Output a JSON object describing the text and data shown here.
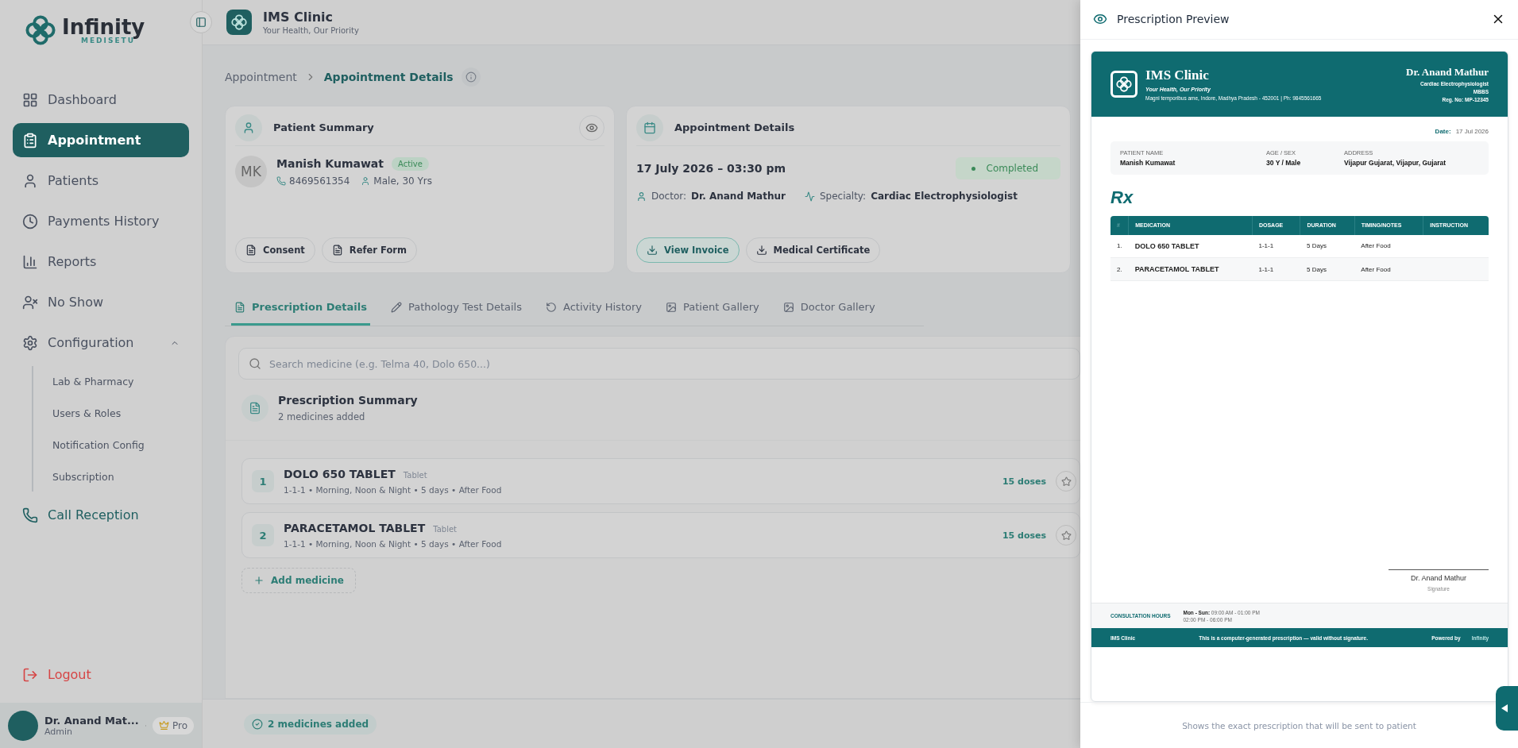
{
  "brand": {
    "name": "Infinity",
    "tagline": "MEDISETU"
  },
  "sidebar": {
    "items": [
      {
        "kind": "dashboard",
        "label": "Dashboard",
        "selected": false
      },
      {
        "kind": "appointment",
        "label": "Appointment",
        "selected": true
      },
      {
        "kind": "patients",
        "label": "Patients",
        "selected": false
      },
      {
        "kind": "payments",
        "label": "Payments History",
        "selected": false
      },
      {
        "kind": "reports",
        "label": "Reports",
        "selected": false
      },
      {
        "kind": "noshow",
        "label": "No Show",
        "selected": false
      },
      {
        "kind": "config",
        "label": "Configuration",
        "selected": false,
        "expanded": true,
        "children": [
          {
            "label": "Lab & Pharmacy"
          },
          {
            "label": "Users & Roles"
          },
          {
            "label": "Notification Config"
          },
          {
            "label": "Subscription"
          }
        ]
      },
      {
        "kind": "call",
        "label": "Call Reception",
        "selected": false
      }
    ],
    "logout": "Logout",
    "user": {
      "name": "Dr. Anand Mat...",
      "role": "Admin",
      "plan": "Pro"
    }
  },
  "header": {
    "clinic": "IMS Clinic",
    "tagline": "Your Health, Our Priority"
  },
  "breadcrumb": [
    "Appointment",
    "Appointment Details"
  ],
  "patient_card": {
    "title": "Patient Summary",
    "initials": "MK",
    "name": "Manish Kumawat",
    "status": "Active",
    "phone": "8469561354",
    "gender_age": "Male, 30 Yrs",
    "buttons": [
      "Consent",
      "Refer Form"
    ]
  },
  "appointment_card": {
    "title": "Appointment Details",
    "datetime": "17 July 2026 – 03:30 pm",
    "status": "Completed",
    "doctor_label": "Doctor:",
    "doctor": "Dr. Anand Mathur",
    "specialty_label": "Specialty:",
    "specialty": "Cardiac Electrophysiologist",
    "buttons": [
      {
        "label": "View Invoice",
        "selected": true
      },
      {
        "label": "Medical Certificate",
        "selected": false
      }
    ]
  },
  "tabs": [
    {
      "kind": "doc",
      "label": "Prescription Details",
      "selected": true
    },
    {
      "kind": "pen",
      "label": "Pathology Test Details",
      "selected": false
    },
    {
      "kind": "history",
      "label": "Activity History",
      "selected": false
    },
    {
      "kind": "image",
      "label": "Patient Gallery",
      "selected": false
    },
    {
      "kind": "image",
      "label": "Doctor Gallery",
      "selected": false
    }
  ],
  "search": {
    "placeholder": "Search medicine (e.g. Telma 40, Dolo 650...)"
  },
  "summary": {
    "title": "Prescription Summary",
    "subtitle": "2 medicines added"
  },
  "medicines": [
    {
      "index": "1",
      "name": "DOLO 650 TABLET",
      "type": "Tablet",
      "detail": "1-1-1 • Morning, Noon & Night • 5 days • After Food",
      "doses": "15 doses"
    },
    {
      "index": "2",
      "name": "PARACETAMOL TABLET",
      "type": "Tablet",
      "detail": "1-1-1 • Morning, Noon & Night • 5 days • After Food",
      "doses": "15 doses"
    }
  ],
  "add_medicine": "Add medicine",
  "footer_badge": "2 medicines added",
  "preview": {
    "title": "Prescription Preview",
    "clinic": "IMS Clinic",
    "tagline": "Your Health, Our Priority",
    "address": "Magni temporibus ame, Indore, Madhya Pradesh - 452001 | Ph: 9845561665",
    "doctor": "Dr. Anand Mathur",
    "specialty": "Cardiac Electrophysiologist",
    "degree": "MBBS",
    "reg": "Reg. No: MP-12345",
    "date_label": "Date:",
    "date": "17 Jul 2026",
    "patient_fields": [
      {
        "label": "PATIENT NAME",
        "value": "Manish Kumawat"
      },
      {
        "label": "AGE / SEX",
        "value": "30 Y / Male"
      },
      {
        "label": "ADDRESS",
        "value": "Vijapur Gujarat, Vijapur, Gujarat"
      }
    ],
    "rx": "Rx",
    "columns": [
      "#",
      "MEDICATION",
      "DOSAGE",
      "DURATION",
      "TIMING/NOTES",
      "INSTRUCTION"
    ],
    "rows": [
      [
        "1.",
        "DOLO 650 TABLET",
        "1-1-1",
        "5 Days",
        "After Food",
        ""
      ],
      [
        "2.",
        "PARACETAMOL TABLET",
        "1-1-1",
        "5 Days",
        "After Food",
        ""
      ]
    ],
    "signature_name": "Dr. Anand Mathur",
    "signature_label": "Signature",
    "hours_label": "CONSULTATION HOURS",
    "hours_days": "Mon - Sun:",
    "hours_1": "09:00 AM - 01:00 PM",
    "hours_2": "02:00 PM - 06:00 PM",
    "footer_clinic": "IMS Clinic",
    "footer_note": "This is a computer-generated prescription — valid without signature.",
    "powered_by": "Powered by",
    "powered_brand": "Infinity",
    "caption": "Shows the exact prescription that will be sent to patient"
  }
}
